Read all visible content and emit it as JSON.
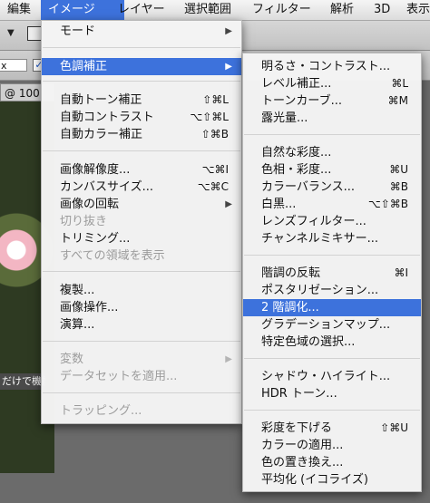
{
  "menubar": {
    "items": [
      {
        "label": "編集"
      },
      {
        "label": "イメージ",
        "active": true
      },
      {
        "label": "レイヤー"
      },
      {
        "label": "選択範囲"
      },
      {
        "label": "フィルター"
      },
      {
        "label": "解析"
      },
      {
        "label": "3D"
      },
      {
        "label": "表示"
      }
    ]
  },
  "toolbar": {
    "dropdown_arrow": "▼",
    "field_value": "x",
    "checkbox_mark": "✓"
  },
  "document": {
    "tab_label": "@ 100",
    "footer_text": "だけで機能"
  },
  "image_menu": {
    "items": [
      {
        "label": "モード",
        "submenu": true
      },
      {
        "label": "色調補正",
        "submenu": true,
        "highlighted": true
      },
      {
        "label": "自動トーン補正",
        "shortcut": "⇧⌘L"
      },
      {
        "label": "自動コントラスト",
        "shortcut": "⌥⇧⌘L"
      },
      {
        "label": "自動カラー補正",
        "shortcut": "⇧⌘B"
      },
      {
        "label": "画像解像度...",
        "shortcut": "⌥⌘I"
      },
      {
        "label": "カンバスサイズ...",
        "shortcut": "⌥⌘C"
      },
      {
        "label": "画像の回転",
        "submenu": true
      },
      {
        "label": "切り抜き",
        "disabled": true
      },
      {
        "label": "トリミング..."
      },
      {
        "label": "すべての領域を表示",
        "disabled": true
      },
      {
        "label": "複製..."
      },
      {
        "label": "画像操作..."
      },
      {
        "label": "演算..."
      },
      {
        "label": "変数",
        "submenu": true,
        "disabled": true
      },
      {
        "label": "データセットを適用...",
        "disabled": true
      },
      {
        "label": "トラッピング...",
        "disabled": true
      }
    ]
  },
  "adjustments_menu": {
    "items": [
      {
        "label": "明るさ・コントラスト..."
      },
      {
        "label": "レベル補正...",
        "shortcut": "⌘L"
      },
      {
        "label": "トーンカーブ...",
        "shortcut": "⌘M"
      },
      {
        "label": "露光量..."
      },
      {
        "label": "自然な彩度..."
      },
      {
        "label": "色相・彩度...",
        "shortcut": "⌘U"
      },
      {
        "label": "カラーバランス...",
        "shortcut": "⌘B"
      },
      {
        "label": "白黒...",
        "shortcut": "⌥⇧⌘B"
      },
      {
        "label": "レンズフィルター..."
      },
      {
        "label": "チャンネルミキサー..."
      },
      {
        "label": "階調の反転",
        "shortcut": "⌘I"
      },
      {
        "label": "ポスタリゼーション..."
      },
      {
        "label": "2 階調化...",
        "highlighted": true
      },
      {
        "label": "グラデーションマップ..."
      },
      {
        "label": "特定色域の選択..."
      },
      {
        "label": "シャドウ・ハイライト..."
      },
      {
        "label": "HDR トーン..."
      },
      {
        "label": "彩度を下げる",
        "shortcut": "⇧⌘U"
      },
      {
        "label": "カラーの適用..."
      },
      {
        "label": "色の置き換え..."
      },
      {
        "label": "平均化 (イコライズ)"
      }
    ]
  },
  "colors": {
    "highlight": "#3d72dc"
  }
}
